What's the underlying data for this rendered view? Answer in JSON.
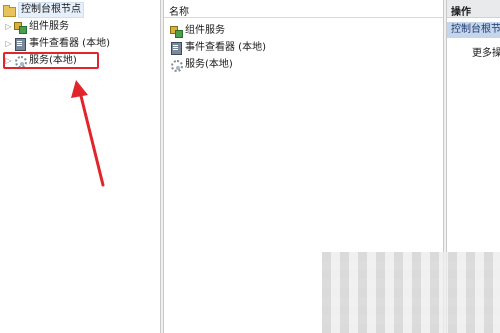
{
  "tree": {
    "root_label": "控制台根节点",
    "items": [
      {
        "label": "组件服务",
        "icon": "component-services-icon"
      },
      {
        "label": "事件查看器 (本地)",
        "icon": "event-viewer-icon"
      },
      {
        "label": "服务(本地)",
        "icon": "services-gear-icon"
      }
    ]
  },
  "list": {
    "column_name": "名称",
    "rows": [
      {
        "label": "组件服务",
        "icon": "component-services-icon"
      },
      {
        "label": "事件查看器 (本地)",
        "icon": "event-viewer-icon"
      },
      {
        "label": "服务(本地)",
        "icon": "services-gear-icon"
      }
    ]
  },
  "actions": {
    "header": "操作",
    "section": "控制台根节点",
    "more": "更多操作"
  },
  "colors": {
    "annotation_red": "#e0262c",
    "action_section_bg": "#c5d6ec",
    "selection_bg": "#e5f0fb"
  }
}
